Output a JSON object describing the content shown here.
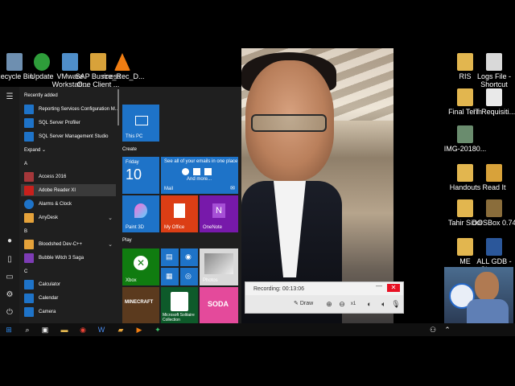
{
  "desktop_icons_left": [
    {
      "label": "Recycle Bin",
      "color": "#6e8fb0"
    },
    {
      "label": "Update",
      "color": "#2e9d3a"
    },
    {
      "label": "VMware Workstati...",
      "color": "#4f8ec9"
    },
    {
      "label": "SAP Business One Client ...",
      "color": "#d8a23a"
    },
    {
      "label": "rce_Rec_D...",
      "color": "#f07d12"
    }
  ],
  "desktop_icons_right": [
    {
      "label": "RIS",
      "color": "#e2b64f"
    },
    {
      "label": "Logs File - Shortcut",
      "color": "#d9d9d9"
    },
    {
      "label": "Final Term",
      "color": "#e2b64f"
    },
    {
      "label": "IT Requisiti...",
      "color": "#e9e9e9"
    },
    {
      "label": "IMG-20180...",
      "color": "#6a8c6e"
    },
    {
      "label": "Handouts",
      "color": "#e2b64f"
    },
    {
      "label": "Read It",
      "color": "#d8a23a"
    },
    {
      "label": "Tahir Siddi",
      "color": "#e2b64f"
    },
    {
      "label": "DOSBox 0.74",
      "color": "#8a6d3b"
    },
    {
      "label": "ME",
      "color": "#e2b64f"
    },
    {
      "label": "ALL GDB - Shortcut",
      "color": "#2b579a"
    }
  ],
  "start_menu": {
    "recently_added_header": "Recently added",
    "recent_items": [
      {
        "label": "Reporting Services Configuration M...",
        "color": "#1e73c8"
      },
      {
        "label": "SQL Server Profiler",
        "color": "#1e73c8"
      },
      {
        "label": "SQL Server Management Studio",
        "color": "#1e73c8"
      }
    ],
    "expand_label": "Expand",
    "letter_a": "A",
    "a_items": [
      {
        "label": "Access 2016",
        "color": "#a4373a"
      },
      {
        "label": "Adobe Reader XI",
        "color": "#c8201c"
      },
      {
        "label": "Alarms & Clock",
        "color": "#1e73c8"
      },
      {
        "label": "AnyDesk",
        "color": "#e5a23a"
      }
    ],
    "letter_b": "B",
    "b_items": [
      {
        "label": "Bloodshed Dev-C++",
        "color": "#e5a23a"
      },
      {
        "label": "Bubble Witch 3 Saga",
        "color": "#7d3cb5"
      }
    ],
    "letter_c": "C",
    "c_items": [
      {
        "label": "Calculator",
        "color": "#1e73c8"
      },
      {
        "label": "Calendar",
        "color": "#1e73c8"
      },
      {
        "label": "Camera",
        "color": "#1e73c8"
      }
    ],
    "tiles": {
      "this_pc": "This PC",
      "create_header": "Create",
      "calendar_day": "Friday",
      "calendar_date": "10",
      "mail_caption": "See all of your emails in one place",
      "mail_more": "And more...",
      "mail_label": "Mail",
      "paint3d": "Paint 3D",
      "my_office": "My Office",
      "onenote": "OneNote",
      "play_header": "Play",
      "xbox": "Xbox",
      "photos": "Photos",
      "minecraft": "MINECRAFT",
      "solitaire": "Microsoft Solitaire Collection",
      "soda": "SODA"
    }
  },
  "recorder": {
    "status_label": "Recording:",
    "time": "00:13:06",
    "draw_label": "Draw",
    "zoom_level": "x1",
    "close_glyph": "✕",
    "minimize_glyph": "—"
  },
  "taskbar_icons": [
    "windows-start",
    "search",
    "task-view",
    "chrome",
    "file-explorer",
    "word",
    "media-player",
    "recorder",
    "sap"
  ]
}
